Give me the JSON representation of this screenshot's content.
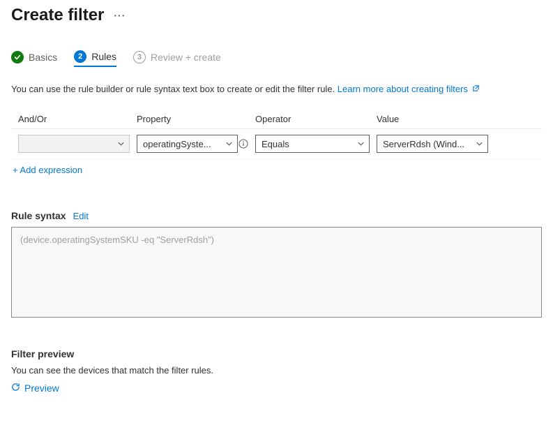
{
  "header": {
    "title": "Create filter"
  },
  "steps": {
    "basics": "Basics",
    "rules": "Rules",
    "review": "Review + create",
    "num2": "2",
    "num3": "3"
  },
  "intro": {
    "text": "You can use the rule builder or rule syntax text box to create or edit the filter rule. ",
    "link": "Learn more about creating filters"
  },
  "columns": {
    "andor": "And/Or",
    "property": "Property",
    "operator": "Operator",
    "value": "Value"
  },
  "row": {
    "andor": "",
    "property": "operatingSyste...",
    "operator": "Equals",
    "value": "ServerRdsh (Wind..."
  },
  "addExpression": "+ Add expression",
  "syntax": {
    "label": "Rule syntax",
    "edit": "Edit",
    "value": "(device.operatingSystemSKU -eq \"ServerRdsh\")"
  },
  "preview": {
    "title": "Filter preview",
    "desc": "You can see the devices that match the filter rules.",
    "link": "Preview"
  }
}
